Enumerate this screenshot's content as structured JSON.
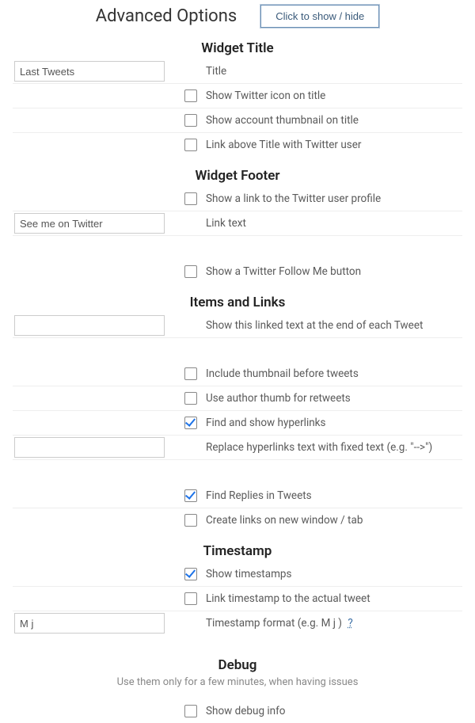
{
  "header": {
    "title": "Advanced Options",
    "toggle_button": "Click to show / hide"
  },
  "sections": {
    "widget_title": {
      "heading": "Widget Title",
      "title_value": "Last Tweets",
      "title_label": "Title",
      "show_icon": "Show Twitter icon on title",
      "show_thumb": "Show account thumbnail on title",
      "link_above": "Link above Title with Twitter user"
    },
    "widget_footer": {
      "heading": "Widget Footer",
      "show_link_profile": "Show a link to the Twitter user profile",
      "link_text_value": "See me on Twitter",
      "link_text_label": "Link text",
      "show_follow_btn": "Show a Twitter Follow Me button"
    },
    "items_links": {
      "heading": "Items and Links",
      "linked_text_value": "",
      "linked_text_label": "Show this linked text at the end of each Tweet",
      "include_thumb": "Include thumbnail before tweets",
      "author_thumb_rt": "Use author thumb for retweets",
      "find_hyperlinks": "Find and show hyperlinks",
      "replace_text_value": "",
      "replace_text_label": "Replace hyperlinks text with fixed text (e.g. \"-->\")",
      "find_replies": "Find Replies in Tweets",
      "new_window": "Create links on new window / tab"
    },
    "timestamp": {
      "heading": "Timestamp",
      "show_ts": "Show timestamps",
      "link_ts": "Link timestamp to the actual tweet",
      "format_value": "M j",
      "format_label": "Timestamp format (e.g. M j )",
      "help": "?"
    },
    "debug": {
      "heading": "Debug",
      "note": "Use them only for a few minutes, when having issues",
      "show_debug": "Show debug info"
    }
  }
}
